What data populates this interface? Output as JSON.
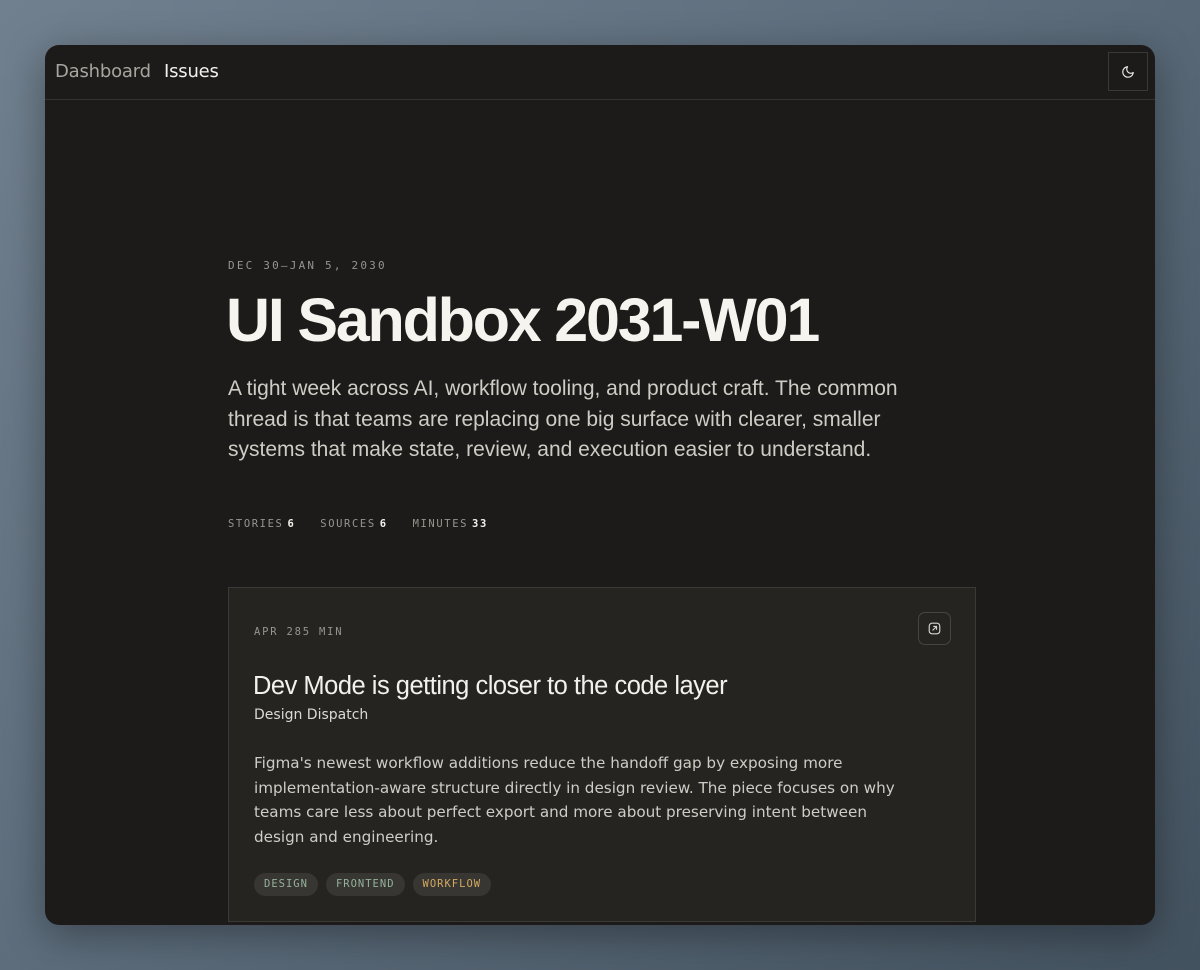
{
  "nav": {
    "dashboard_label": "Dashboard",
    "issues_label": "Issues",
    "theme_icon": "moon-icon"
  },
  "issue": {
    "date_range": "DEC 30–JAN 5, 2030",
    "title": "UI Sandbox 2031-W01",
    "summary": "A tight week across AI, workflow tooling, and product craft. The common thread is that teams are replacing one big surface with clearer, smaller systems that make state, review, and execution easier to understand.",
    "stats": [
      {
        "label": "STORIES",
        "value": "6"
      },
      {
        "label": "SOURCES",
        "value": "6"
      },
      {
        "label": "MINUTES",
        "value": "33"
      }
    ]
  },
  "stories": [
    {
      "meta": "APR 285 MIN",
      "title": "Dev Mode is getting closer to the code layer",
      "source": "Design Dispatch",
      "excerpt": "Figma's newest workflow additions reduce the handoff gap by exposing more implementation-aware structure directly in design review. The piece focuses on why teams care less about perfect export and more about preserving intent between design and engineering.",
      "open_icon": "external-link-icon",
      "tags": [
        {
          "label": "DESIGN",
          "color": "#94b29a"
        },
        {
          "label": "FRONTEND",
          "color": "#94b29a"
        },
        {
          "label": "WORKFLOW",
          "color": "#d4a95e"
        }
      ]
    }
  ]
}
